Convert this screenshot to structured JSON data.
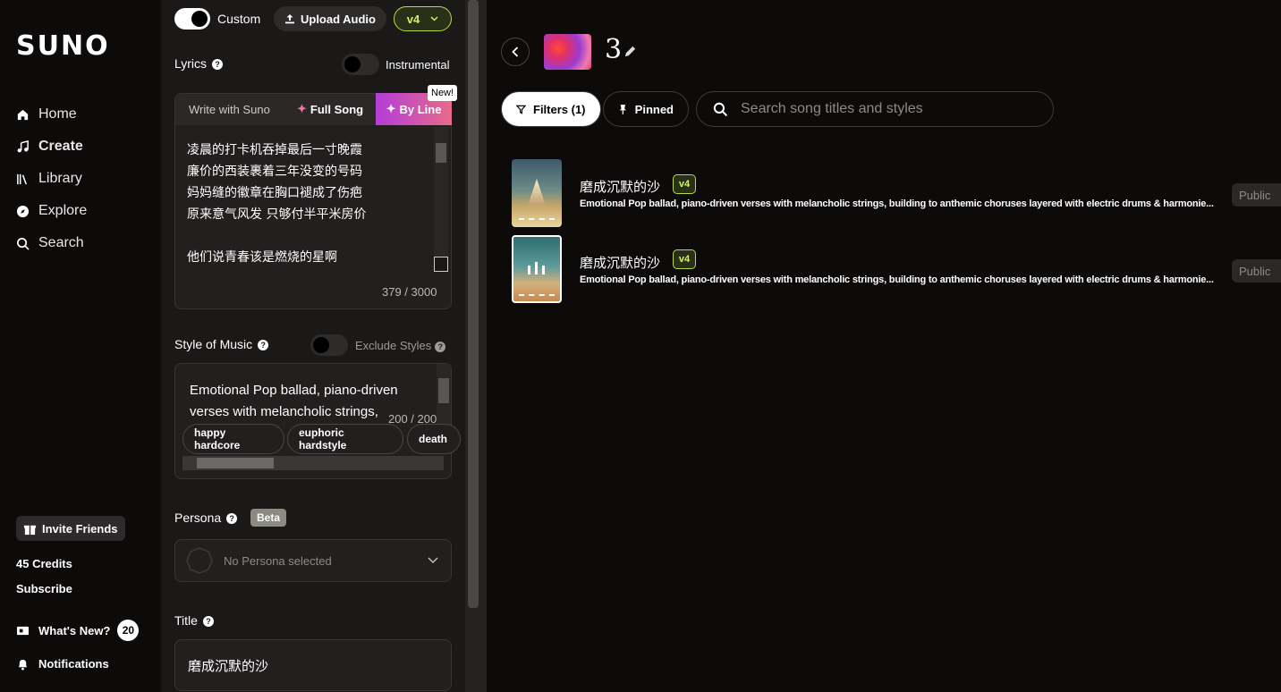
{
  "nav": {
    "logo": "SUNO",
    "items": [
      {
        "label": "Home",
        "icon": "home-icon"
      },
      {
        "label": "Create",
        "icon": "music-note-icon"
      },
      {
        "label": "Library",
        "icon": "library-icon"
      },
      {
        "label": "Explore",
        "icon": "compass-icon"
      },
      {
        "label": "Search",
        "icon": "search-icon"
      }
    ],
    "invite": "Invite Friends",
    "credits": "45 Credits",
    "subscribe": "Subscribe",
    "whats_new": "What's New?",
    "whats_new_count": "20",
    "notifications": "Notifications"
  },
  "create": {
    "custom_label": "Custom",
    "upload_label": "Upload Audio",
    "model": "v4",
    "lyrics_label": "Lyrics",
    "instrumental_label": "Instrumental",
    "tabs": {
      "write": "Write with Suno",
      "full": "Full Song",
      "byline": "By Line",
      "new_badge": "New!"
    },
    "lyrics_text": "凌晨的打卡机吞掉最后一寸晚霞\n廉价的西装裹着三年没变的号码\n妈妈缝的徽章在胸口褪成了伤疤\n原来意气风发 只够付半平米房价\n\n他们说青春该是燃烧的星啊\n我的火柴却在雨夜里受潮哑巴",
    "lyrics_count": "379 / 3000",
    "style_label": "Style of Music",
    "exclude_label": "Exclude Styles",
    "style_text": "Emotional Pop ballad, piano-driven\nverses with melancholic strings,\nbuilding to anthemic choruses layered",
    "style_count": "200 / 200",
    "tags": [
      "happy hardcore",
      "euphoric hardstyle",
      "death"
    ],
    "persona_label": "Persona",
    "persona_badge": "Beta",
    "persona_placeholder": "No Persona selected",
    "title_label": "Title",
    "title_value": "磨成沉默的沙"
  },
  "workspace": {
    "name": "3",
    "filters": "Filters (1)",
    "pinned": "Pinned",
    "search_placeholder": "Search song titles and styles",
    "songs": [
      {
        "title": "磨成沉默的沙",
        "version": "v4",
        "desc": "Emotional Pop ballad, piano-driven verses with melancholic strings, building to anthemic choruses layered with electric drums & harmonie...",
        "visibility": "Public"
      },
      {
        "title": "磨成沉默的沙",
        "version": "v4",
        "desc": "Emotional Pop ballad, piano-driven verses with melancholic strings, building to anthemic choruses layered with electric drums & harmonie...",
        "visibility": "Public"
      }
    ]
  },
  "colors": {
    "accent_lime": "#d2f55a",
    "byline_gradient_start": "#b43dd8",
    "byline_gradient_end": "#e86a8a"
  }
}
